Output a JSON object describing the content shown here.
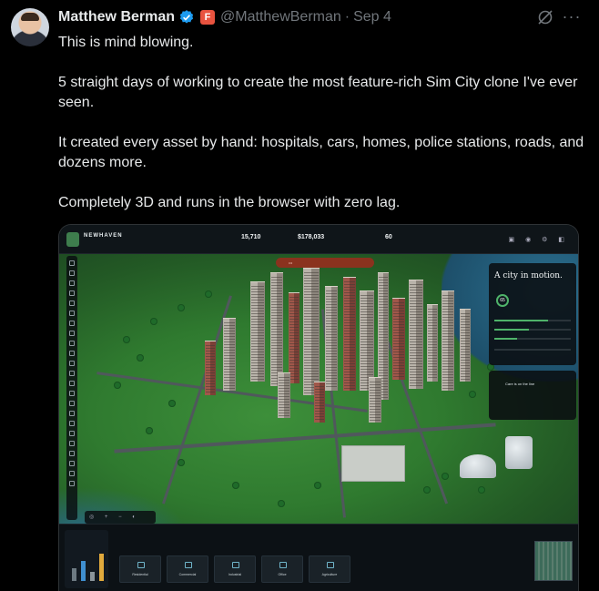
{
  "tweet": {
    "author_name": "Matthew Berman",
    "handle": "@MatthewBerman",
    "separator": "·",
    "date": "Sep 4",
    "more_label": "···",
    "paragraphs": [
      "This is mind blowing.",
      "5 straight days of working to create the most feature-rich Sim City clone I've ever seen.",
      "It created every asset by hand: hospitals, cars, homes, police stations, roads, and dozens more.",
      "Completely 3D and runs in the browser with zero lag."
    ]
  },
  "game": {
    "city_name": "NEWHAVEN",
    "stats": [
      {
        "value": "15,710"
      },
      {
        "value": "$178,033"
      },
      {
        "value": "60"
      }
    ],
    "panel": {
      "headline": "A city in motion.",
      "ring_value": "65"
    },
    "card_text": "Care is on the line",
    "dock_tiles": [
      "Residential",
      "Commercial",
      "Industrial",
      "Office",
      "Agriculture"
    ]
  },
  "colors": {
    "background": "#000000",
    "text_primary": "#e7e9ea",
    "text_secondary": "#71767b",
    "verified_blue": "#1d9bf0",
    "affiliate_orange": "#e8533f"
  }
}
